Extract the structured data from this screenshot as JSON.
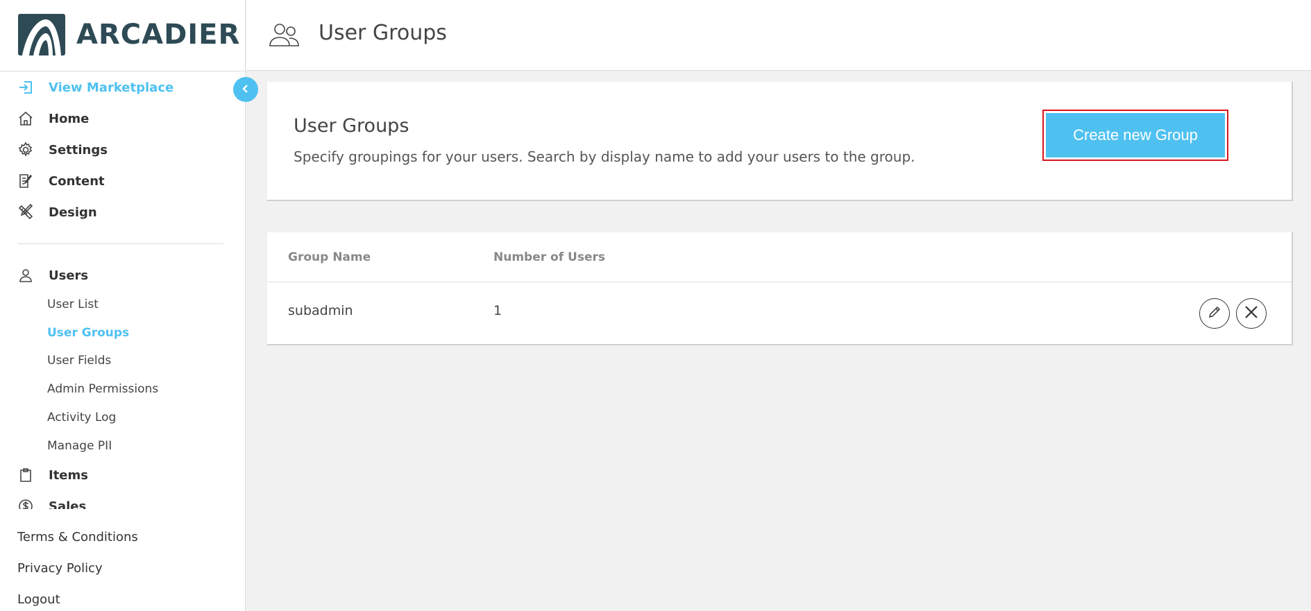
{
  "brand": {
    "name": "ARCADIER",
    "color": "#2d4a55"
  },
  "accent": "#4fc1f0",
  "header": {
    "title": "User Groups"
  },
  "sidebar": {
    "items": [
      {
        "label": "View Marketplace",
        "icon": "enter-icon"
      },
      {
        "label": "Home",
        "icon": "home-icon"
      },
      {
        "label": "Settings",
        "icon": "gear-icon"
      },
      {
        "label": "Content",
        "icon": "edit-document-icon"
      },
      {
        "label": "Design",
        "icon": "ruler-pencil-icon"
      },
      {
        "label": "Users",
        "icon": "user-icon"
      },
      {
        "label": "Items",
        "icon": "clipboard-icon"
      },
      {
        "label": "Sales",
        "icon": "dollar-icon"
      }
    ],
    "users_sub": [
      "User List",
      "User Groups",
      "User Fields",
      "Admin Permissions",
      "Activity Log",
      "Manage PII"
    ],
    "footer": [
      "Terms & Conditions",
      "Privacy Policy",
      "Logout"
    ]
  },
  "intro": {
    "title": "User Groups",
    "description": "Specify groupings for your users. Search by display name to add your users to the group.",
    "create_label": "Create new Group"
  },
  "table": {
    "columns": [
      "Group Name",
      "Number of Users"
    ],
    "rows": [
      {
        "name": "subadmin",
        "count": "1"
      }
    ]
  }
}
